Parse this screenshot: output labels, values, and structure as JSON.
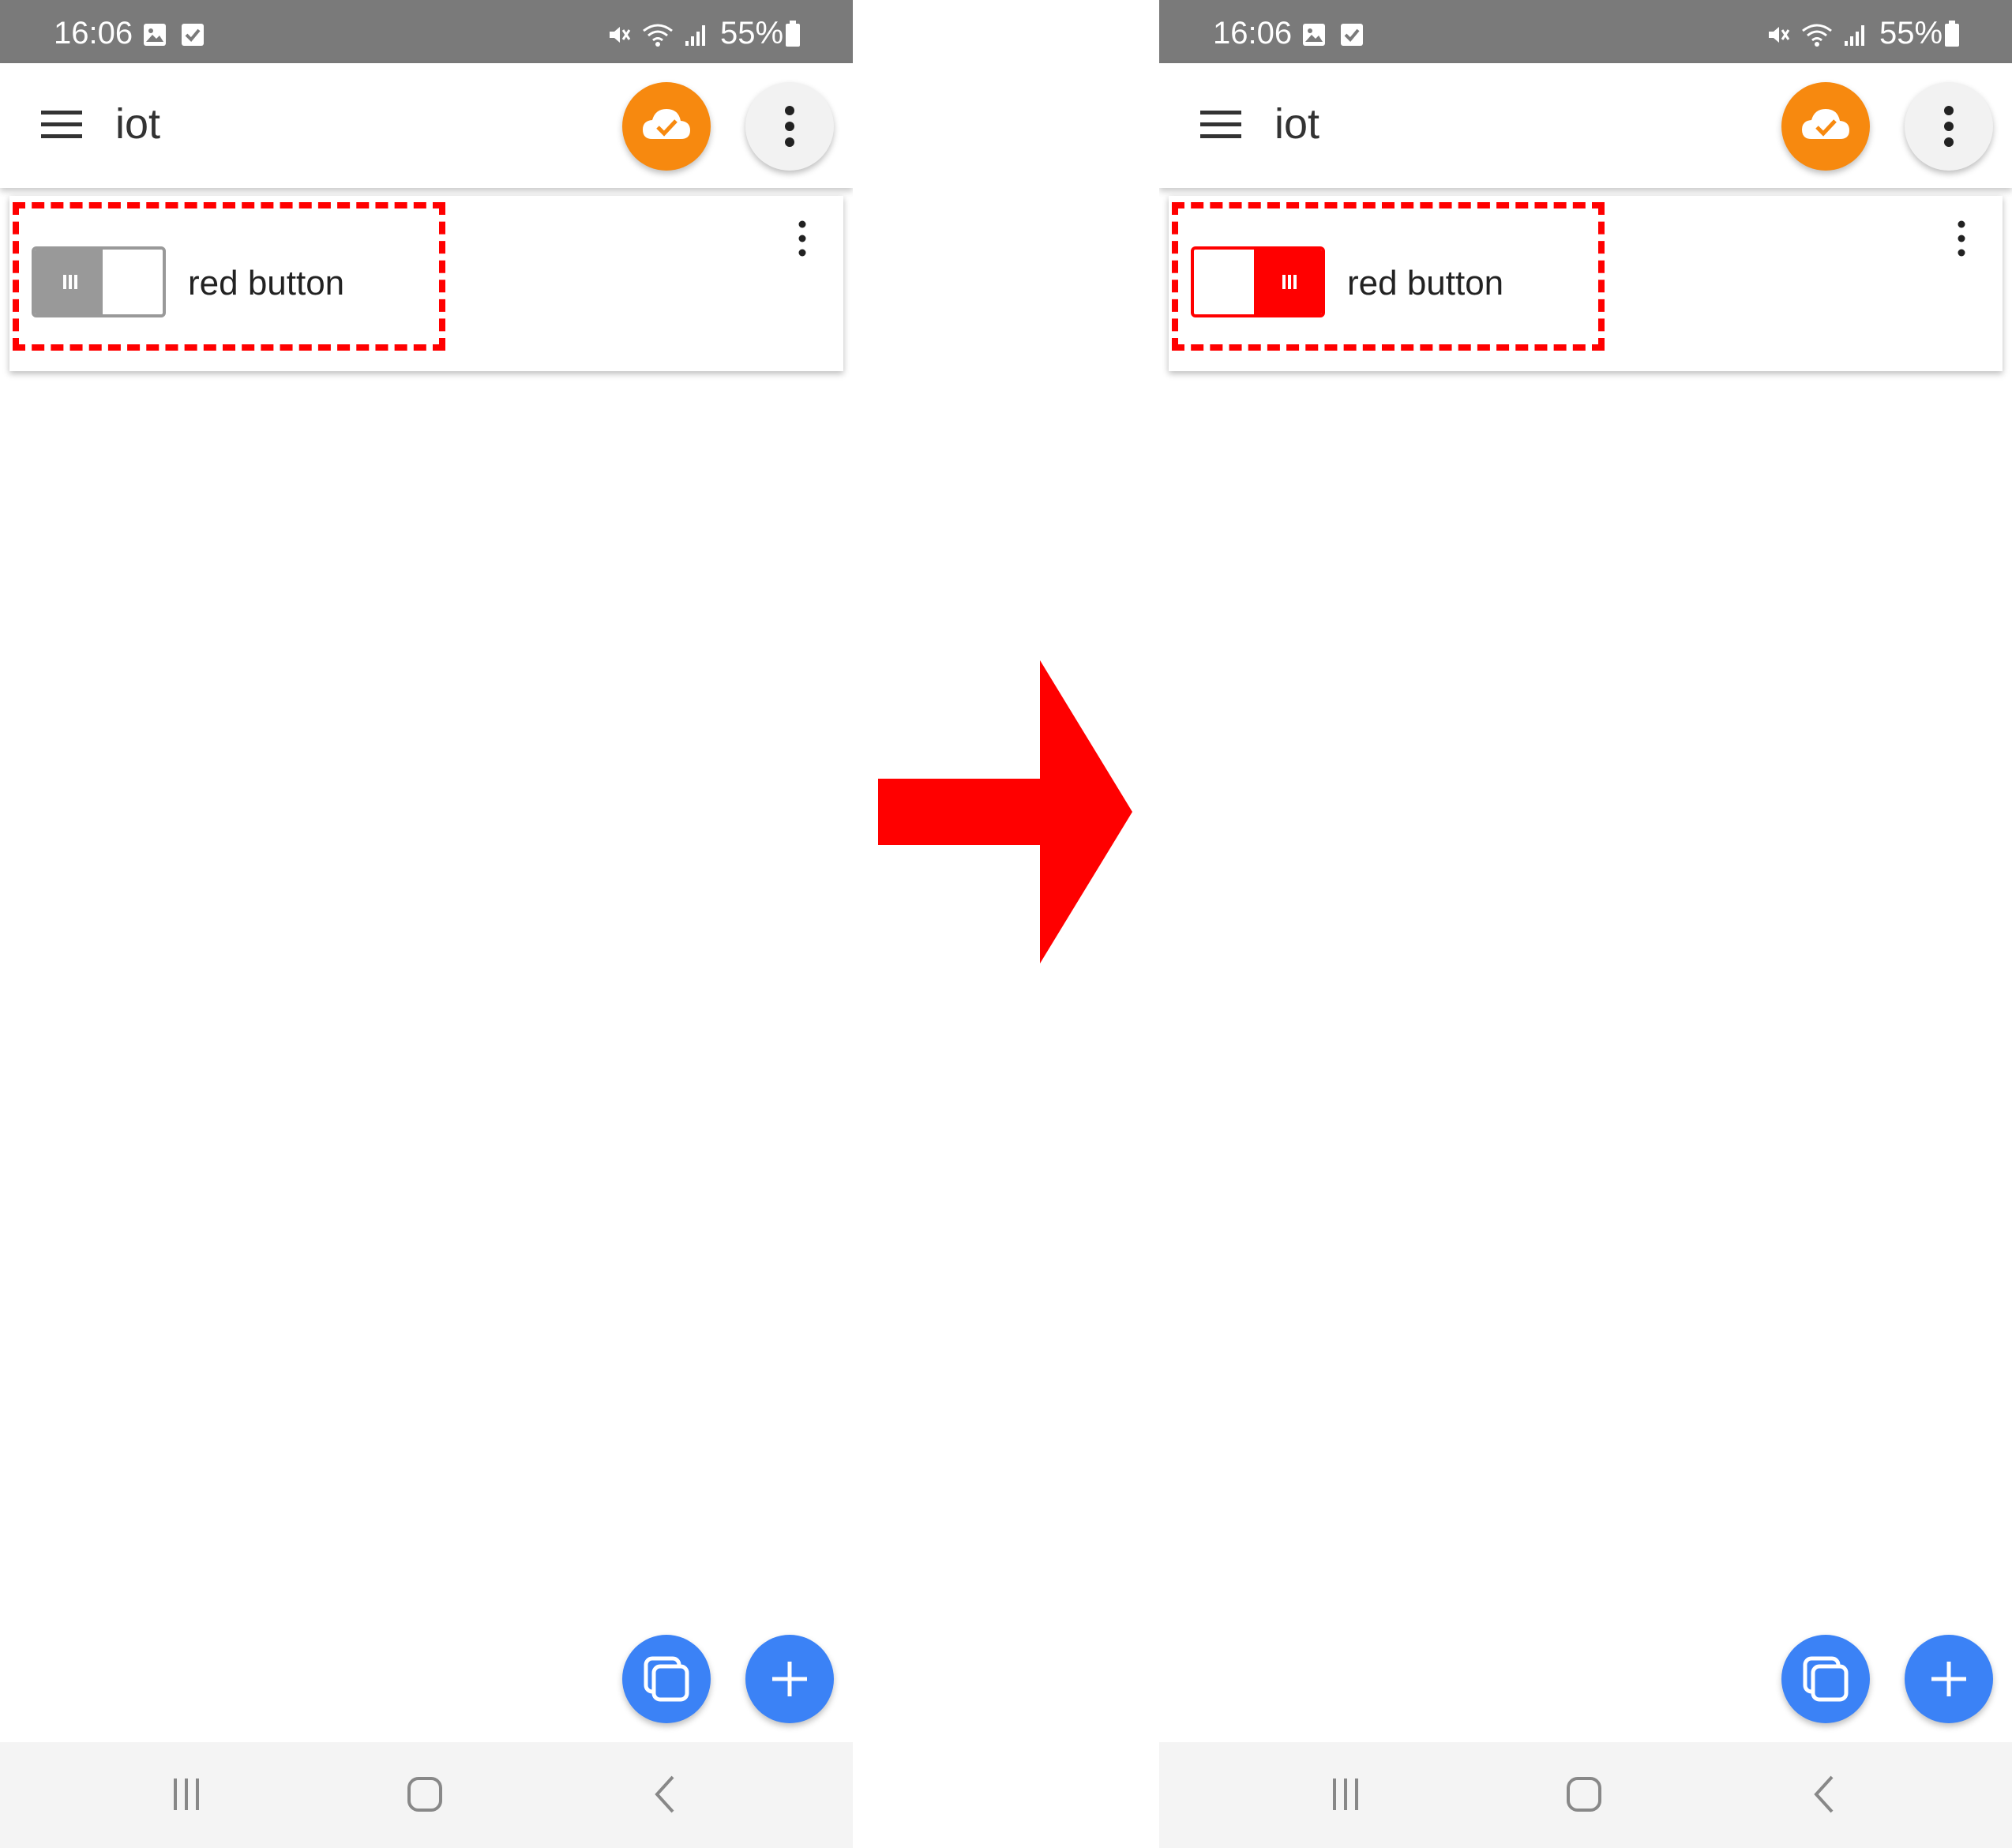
{
  "screens": [
    {
      "state": "off",
      "status_bar": {
        "time": "16:06",
        "battery": "55%"
      },
      "app_bar": {
        "title": "iot"
      },
      "card": {
        "item_label": "red button",
        "toggle_on": false
      }
    },
    {
      "state": "on",
      "status_bar": {
        "time": "16:06",
        "battery": "55%"
      },
      "app_bar": {
        "title": "iot"
      },
      "card": {
        "item_label": "red button",
        "toggle_on": true
      }
    }
  ],
  "colors": {
    "status_bar": "#7a7a7a",
    "cloud_button": "#f7890f",
    "fab": "#3b82f6",
    "toggle_off": "#999999",
    "toggle_on": "#ff0000",
    "highlight": "#ff0000",
    "arrow": "#ff0000"
  },
  "icons": {
    "status_left": [
      "image-icon",
      "checkbox-icon"
    ],
    "status_right": [
      "mute-icon",
      "wifi-icon",
      "signal-icon",
      "battery-icon"
    ],
    "app_bar": [
      "menu-icon",
      "cloud-sync-icon",
      "more-vert-icon"
    ],
    "fabs": [
      "copy-icon",
      "plus-icon"
    ],
    "nav": [
      "recents-icon",
      "home-icon",
      "back-icon"
    ]
  }
}
